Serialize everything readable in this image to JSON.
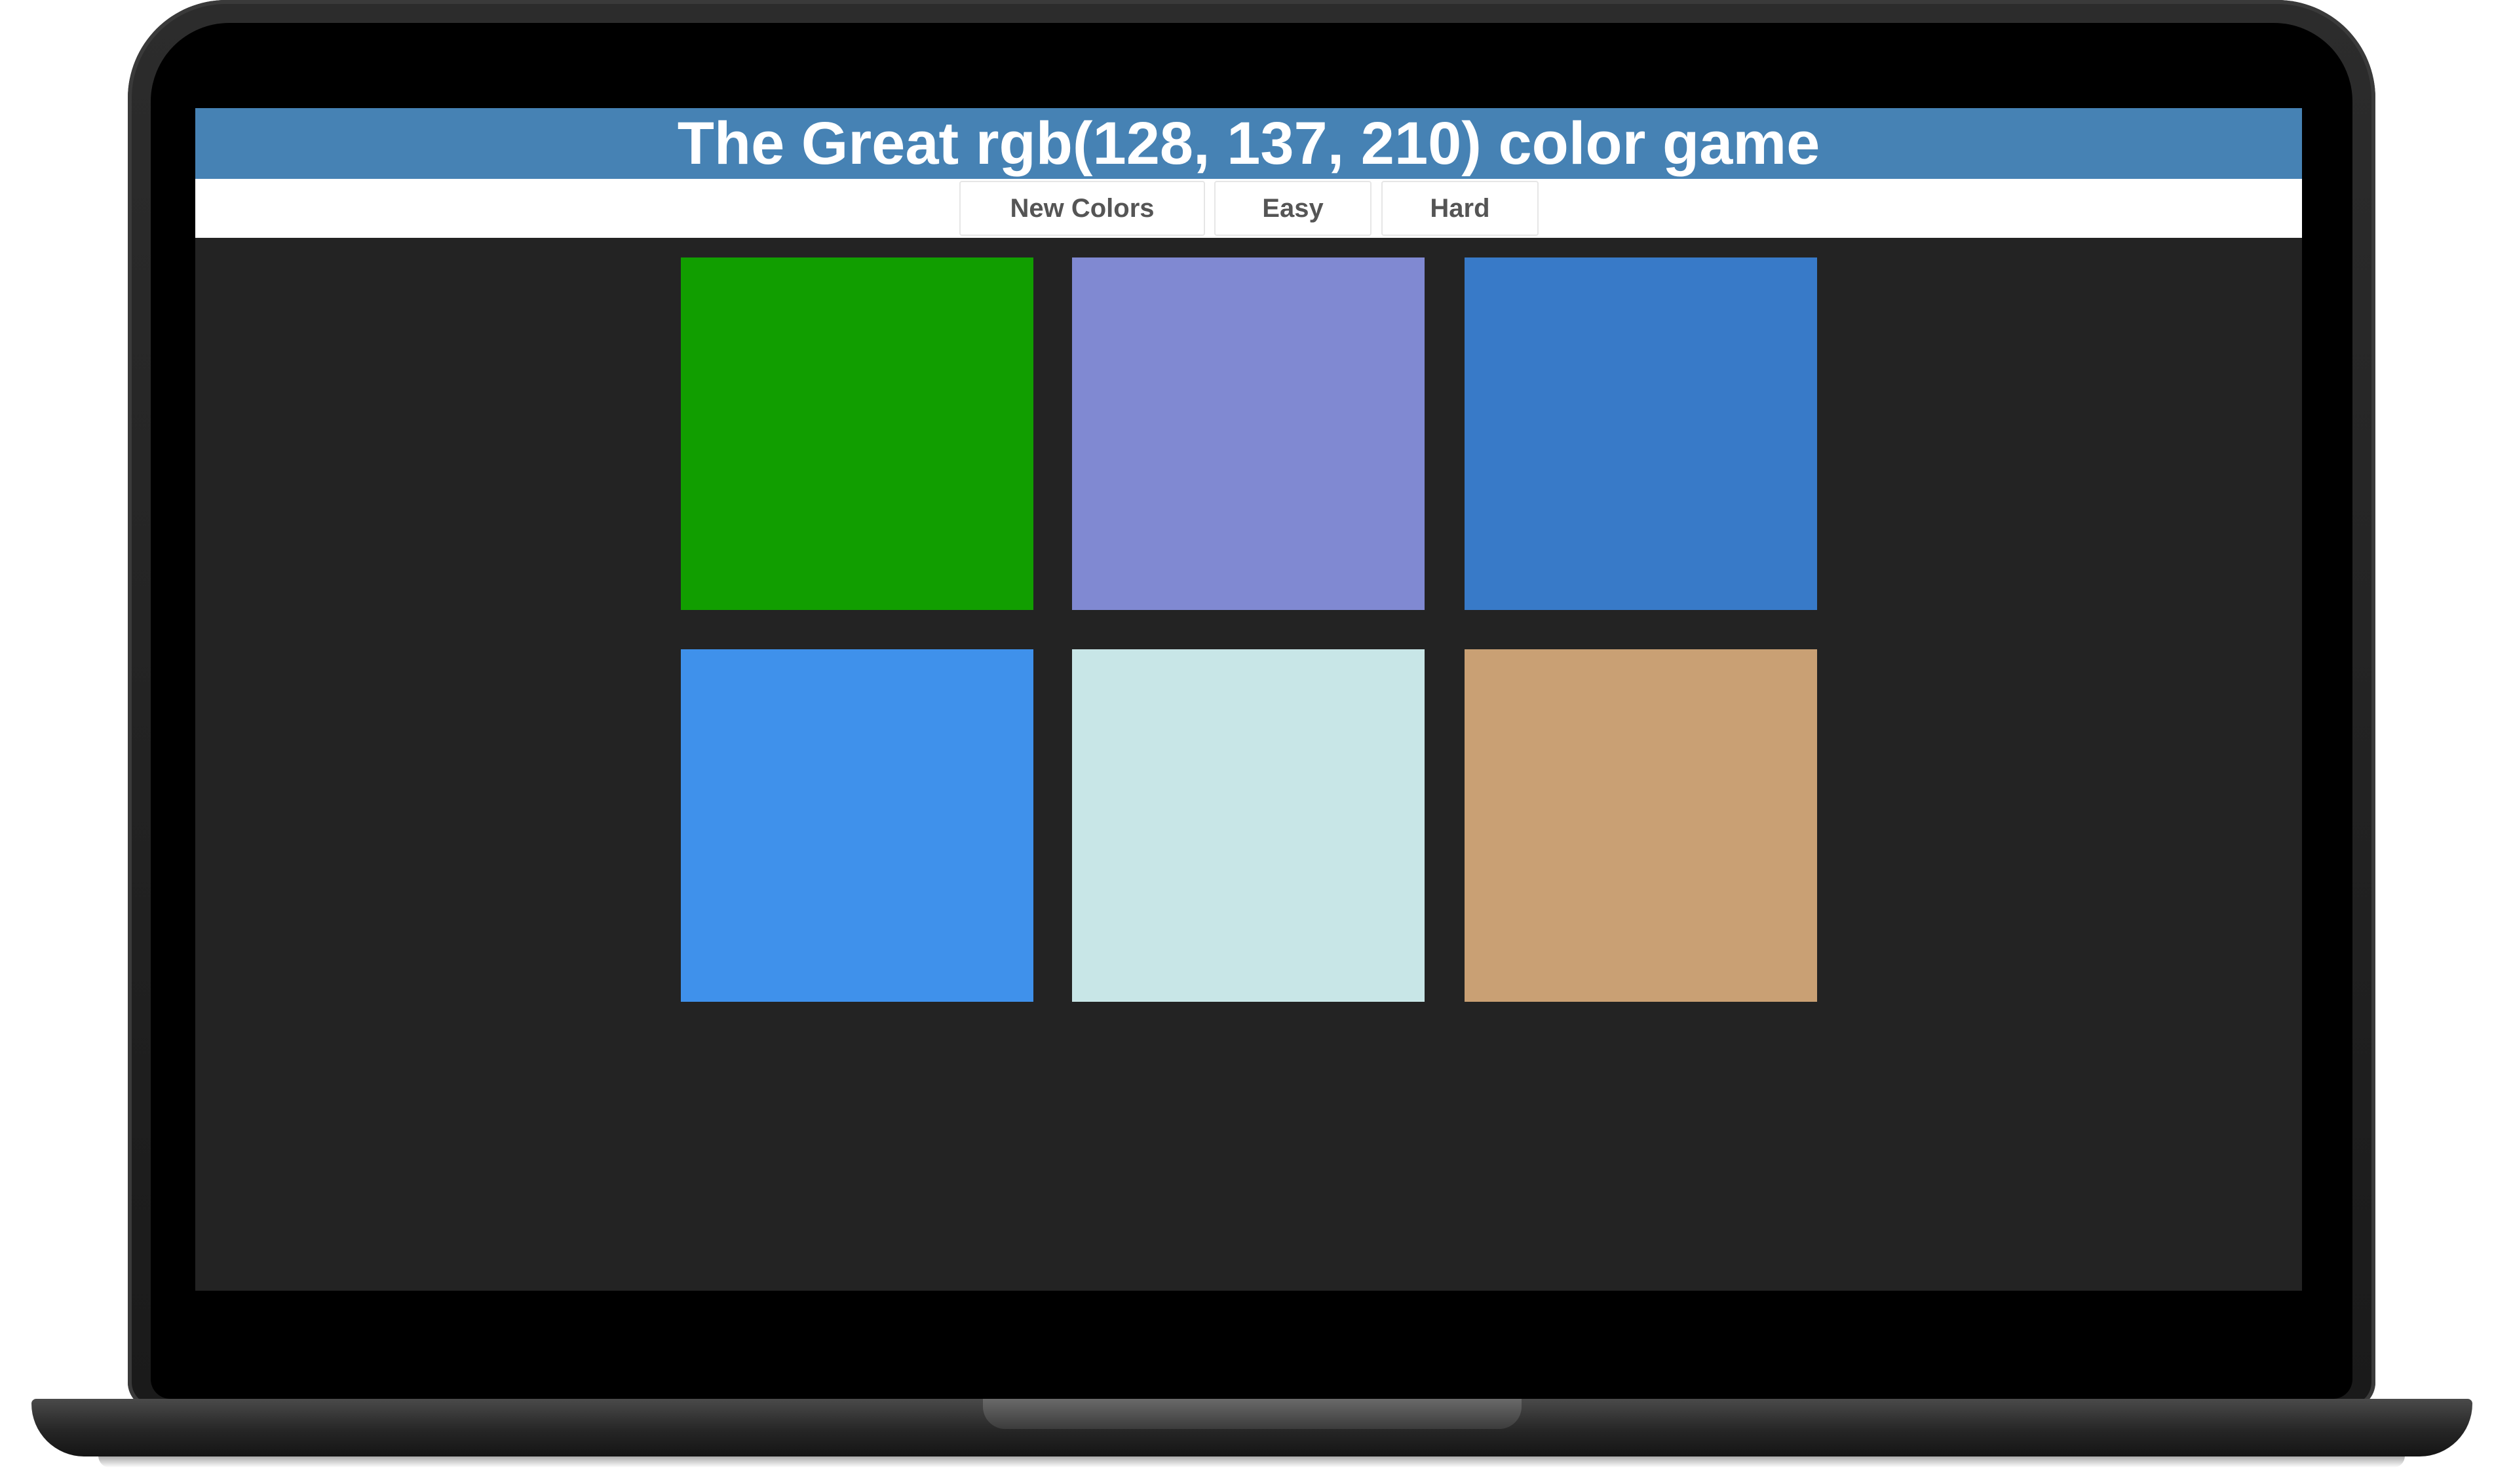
{
  "header": {
    "title": "The Great rgb(128, 137, 210) color game",
    "background": "#4682b4"
  },
  "controls": {
    "new_colors_label": "New Colors",
    "easy_label": "Easy",
    "hard_label": "Hard"
  },
  "squares": [
    {
      "color": "#119e00"
    },
    {
      "color": "#8089d2"
    },
    {
      "color": "#387ac8"
    },
    {
      "color": "#3f91eb"
    },
    {
      "color": "#c8e6e7"
    },
    {
      "color": "#c9a074"
    }
  ],
  "colors": {
    "body_background": "#232323",
    "stripe_background": "#ffffff",
    "button_text": "#555555"
  }
}
